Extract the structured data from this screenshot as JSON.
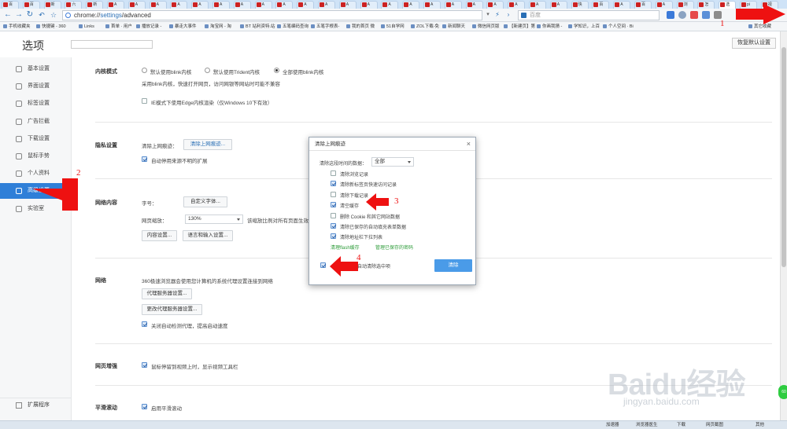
{
  "browser": {
    "tabs": [
      {
        "label": "百",
        "active": false
      },
      {
        "label": "百",
        "active": false
      },
      {
        "label": "新",
        "active": false
      },
      {
        "label": "六",
        "active": false
      },
      {
        "label": "新",
        "active": false
      },
      {
        "label": "A",
        "active": false
      },
      {
        "label": "A",
        "active": false
      },
      {
        "label": "A",
        "active": false
      },
      {
        "label": "A",
        "active": false
      },
      {
        "label": "A",
        "active": false
      },
      {
        "label": "A",
        "active": false
      },
      {
        "label": "A",
        "active": false
      },
      {
        "label": "A",
        "active": false
      },
      {
        "label": "A",
        "active": false
      },
      {
        "label": "A",
        "active": false
      },
      {
        "label": "A",
        "active": false
      },
      {
        "label": "A",
        "active": false
      },
      {
        "label": "A",
        "active": false
      },
      {
        "label": "A",
        "active": false
      },
      {
        "label": "A",
        "active": false
      },
      {
        "label": "A",
        "active": false
      },
      {
        "label": "A",
        "active": false
      },
      {
        "label": "A",
        "active": false
      },
      {
        "label": "A",
        "active": false
      },
      {
        "label": "A",
        "active": false
      },
      {
        "label": "A",
        "active": false
      },
      {
        "label": "A",
        "active": false
      },
      {
        "label": "快",
        "active": false
      },
      {
        "label": "百",
        "active": false
      },
      {
        "label": "A",
        "active": false
      },
      {
        "label": "百",
        "active": false
      },
      {
        "label": "A",
        "active": false
      },
      {
        "label": "浏",
        "active": false
      },
      {
        "label": "怎",
        "active": false
      },
      {
        "label": "选",
        "active": true
      },
      {
        "label": "pi",
        "active": false
      },
      {
        "label": "视",
        "active": false
      }
    ],
    "address": {
      "scheme": "chrome://",
      "host": "settings",
      "path": "/advanced"
    },
    "search_placeholder": "百度",
    "bookmarks": [
      "手机收藏夹",
      "快捷键 - 360",
      "Links",
      "首单 · 用户",
      "播放记录 -",
      "暴走大事件",
      "淘宝网 - 淘",
      "BT 站利资特.站",
      "五笔编码查询",
      "五笔字根表-",
      "我的首页 微",
      "51自学网",
      "ZOL下载-免",
      "新闻聊天",
      "微信网页版",
      "【新建页】第",
      "你画我猜 -",
      "学知识，上百",
      "个人空间 · Bi",
      "其它收藏"
    ]
  },
  "settings": {
    "title": "选项",
    "restore_button": "恢复默认设置",
    "nav": [
      {
        "label": "基本设置",
        "icon": "gear-icon",
        "active": false
      },
      {
        "label": "界面设置",
        "icon": "window-icon",
        "active": false
      },
      {
        "label": "标签设置",
        "icon": "tab-icon",
        "active": false
      },
      {
        "label": "广告拦截",
        "icon": "block-icon",
        "active": false
      },
      {
        "label": "下载设置",
        "icon": "download-icon",
        "active": false
      },
      {
        "label": "鼠标手势",
        "icon": "mouse-icon",
        "active": false
      },
      {
        "label": "个人资料",
        "icon": "person-icon",
        "active": false
      },
      {
        "label": "高级设置",
        "icon": "advanced-icon",
        "active": true
      },
      {
        "label": "实验室",
        "icon": "lab-icon",
        "active": false
      }
    ],
    "extensions_nav": "扩展程序",
    "kernel": {
      "heading": "内核模式",
      "options": [
        "默认使用blink内核",
        "默认使用Trident内核",
        "全部使用blink内核"
      ],
      "selected": 2,
      "note": "采用blink内核，快速打开网页，访问网银等网站时可能不兼容",
      "edge_checkbox": "IE模式下使用Edge内核渲染（仅Windows 10下有效）"
    },
    "privacy": {
      "heading": "隐私设置",
      "clear_label": "清除上网痕迹：",
      "clear_button": "清除上网痕迹...",
      "auto_block": "自动停用来源不明的扩展"
    },
    "web_content": {
      "heading": "网络内容",
      "font_label": "字号：",
      "font_button": "自定义字体...",
      "zoom_label": "网页缩放：",
      "zoom_value": "130%",
      "zoom_note": "该缩放比例对所有页面生效",
      "content_button": "内容设置...",
      "lang_button": "语言和输入设置..."
    },
    "network": {
      "heading": "网络",
      "desc": "360极速浏览器会使用您计算机的系统代理设置连接到网络",
      "proxy_button": "代理服务器设置...",
      "change_proxy_button": "更改代理服务器设置...",
      "auto_detect": "关闭自动检测代理，提高启动速度"
    },
    "web_enhance": {
      "heading": "网页增强",
      "toolbar": "鼠标停留到视频上时，显示视频工具栏"
    },
    "smooth": {
      "heading": "平滑滚动",
      "enable": "启用平滑滚动"
    }
  },
  "dialog": {
    "title": "清除上网痕迹",
    "range_label": "清除这段时间的数据：",
    "range_value": "全部",
    "items": [
      {
        "label": "清除浏览记录",
        "checked": false
      },
      {
        "label": "清除新标签页快速访问记录",
        "checked": true
      },
      {
        "label": "清除下载记录",
        "checked": false
      },
      {
        "label": "清空缓存",
        "checked": true
      },
      {
        "label": "删除 Cookie 和其它网站数据",
        "checked": false
      },
      {
        "label": "清除已保存的自动填充表单数据",
        "checked": true
      },
      {
        "label": "清除地址栏下拉列表",
        "checked": true
      }
    ],
    "link_flash": "清理flash缓存",
    "link_passwords": "管理已保存的密码",
    "exit_option": "时自动清除选中项",
    "exit_checked": true,
    "clear_button": "清除",
    "close": "×"
  },
  "annotations": [
    "1",
    "2",
    "3",
    "4"
  ],
  "statusbar": [
    "加速器",
    "浏览器医生",
    "下载",
    "网页截图",
    "其他"
  ],
  "watermark": {
    "logo": "Baidu经验",
    "url": "jingyan.baidu.com"
  },
  "colors": {
    "accent": "#2f7fd8",
    "annotation": "#e11111",
    "link": "#2e9c3a"
  }
}
